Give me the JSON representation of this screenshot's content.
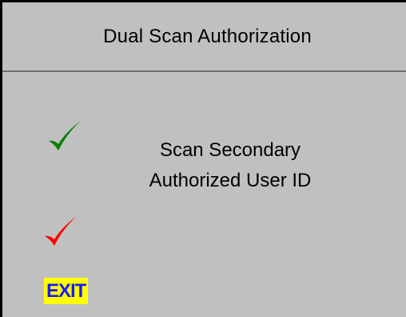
{
  "window": {
    "title": "Dual Scan Authorization"
  },
  "status": {
    "first_scan_icon": "checkmark-icon",
    "first_scan_color": "#008000",
    "second_scan_icon": "checkmark-icon",
    "second_scan_color": "#ff0000"
  },
  "prompt": {
    "line1": "Scan Secondary",
    "line2": "Authorized User ID"
  },
  "actions": {
    "exit_label": "EXIT",
    "exit_bg_color": "#ffff00",
    "exit_text_color": "#1a1aff"
  },
  "colors": {
    "background": "#c0c0c0"
  }
}
